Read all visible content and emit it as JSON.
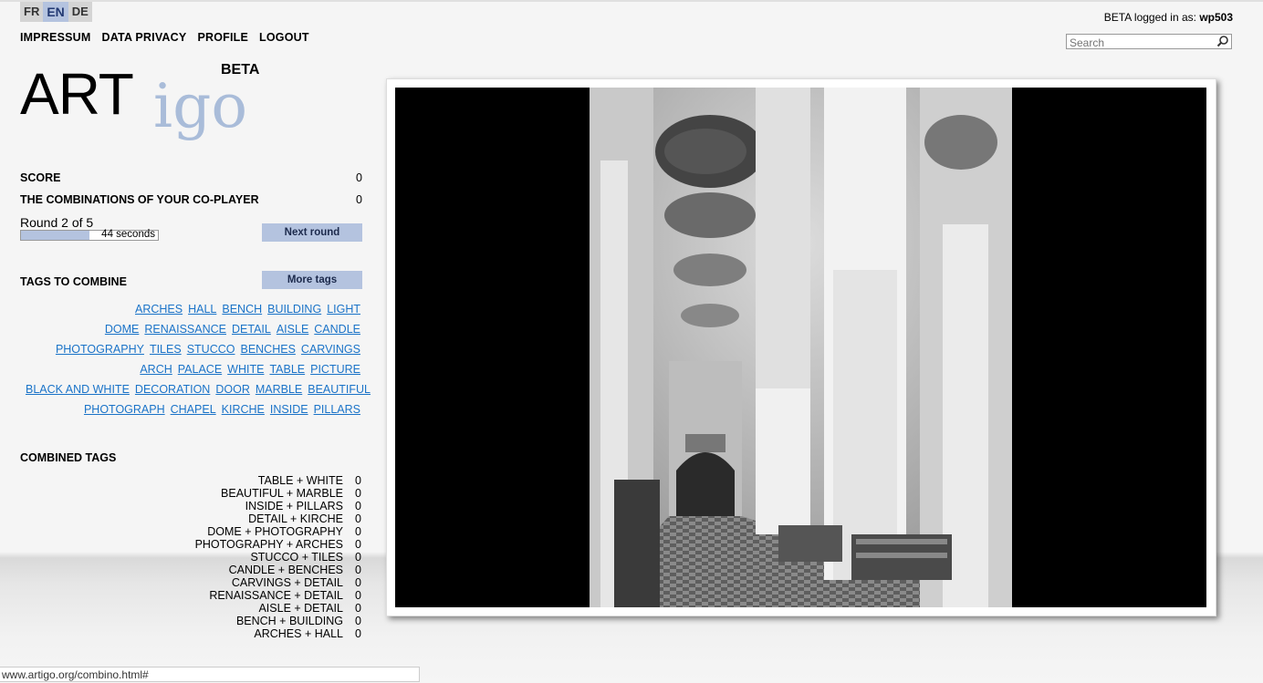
{
  "languages": [
    {
      "code": "FR",
      "active": false
    },
    {
      "code": "EN",
      "active": true
    },
    {
      "code": "DE",
      "active": false
    }
  ],
  "nav": [
    "IMPRESSUM",
    "DATA PRIVACY",
    "PROFILE",
    "LOGOUT"
  ],
  "login": {
    "prefix": "BETA logged in as: ",
    "user": "wp503"
  },
  "search": {
    "placeholder": "Search",
    "icon": "search-icon"
  },
  "logo": {
    "art": "ART",
    "igo": "igo",
    "beta": "BETA"
  },
  "score": {
    "label": "SCORE",
    "value": "0"
  },
  "coplayer": {
    "label": "THE COMBINATIONS OF YOUR CO-PLAYER",
    "value": "0"
  },
  "round": {
    "label": "Round 2 of 5",
    "timer": "44 seconds",
    "progress": 0.5
  },
  "buttons": {
    "next_round": "Next round",
    "more_tags": "More tags"
  },
  "tags_title": "TAGS TO COMBINE",
  "tags": [
    [
      "ARCHES",
      "HALL",
      "BENCH",
      "BUILDING",
      "LIGHT"
    ],
    [
      "DOME",
      "RENAISSANCE",
      "DETAIL",
      "AISLE",
      "CANDLE"
    ],
    [
      "PHOTOGRAPHY",
      "TILES",
      "STUCCO",
      "BENCHES",
      "CARVINGS"
    ],
    [
      "ARCH",
      "PALACE",
      "WHITE",
      "TABLE",
      "PICTURE"
    ],
    [
      "BLACK AND WHITE",
      "DECORATION",
      "DOOR",
      "MARBLE",
      "BEAUTIFUL"
    ],
    [
      "PHOTOGRAPH",
      "CHAPEL",
      "KIRCHE",
      "INSIDE",
      "PILLARS"
    ]
  ],
  "combined_title": "COMBINED TAGS",
  "combined": [
    {
      "pair": "TABLE + WHITE",
      "score": "0"
    },
    {
      "pair": "BEAUTIFUL + MARBLE",
      "score": "0"
    },
    {
      "pair": "INSIDE + PILLARS",
      "score": "0"
    },
    {
      "pair": "DETAIL + KIRCHE",
      "score": "0"
    },
    {
      "pair": "DOME + PHOTOGRAPHY",
      "score": "0"
    },
    {
      "pair": "PHOTOGRAPHY + ARCHES",
      "score": "0"
    },
    {
      "pair": "STUCCO + TILES",
      "score": "0"
    },
    {
      "pair": "CANDLE + BENCHES",
      "score": "0"
    },
    {
      "pair": "CARVINGS + DETAIL",
      "score": "0"
    },
    {
      "pair": "RENAISSANCE + DETAIL",
      "score": "0"
    },
    {
      "pair": "AISLE + DETAIL",
      "score": "0"
    },
    {
      "pair": "BENCH + BUILDING",
      "score": "0"
    },
    {
      "pair": "ARCHES + HALL",
      "score": "0"
    }
  ],
  "status_url": "www.artigo.org/combino.html#",
  "colors": {
    "accent": "#b4c3df",
    "link": "#1a73c8",
    "logo_igo": "#a9bcd9"
  }
}
